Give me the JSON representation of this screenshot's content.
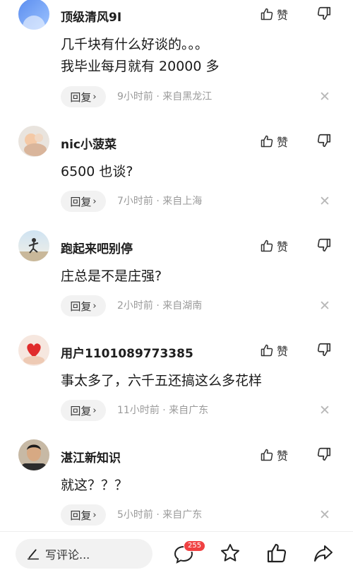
{
  "comments": [
    {
      "username": "顶级清风9I",
      "like_label": "赞",
      "lines": [
        "几千块有什么好谈的。。。",
        "我毕业每月就有 20000 多"
      ],
      "reply_label": "回复",
      "meta": "9小时前 · 来自黑龙江"
    },
    {
      "username": "nic小菠菜",
      "like_label": "赞",
      "lines": [
        "6500 也谈?"
      ],
      "reply_label": "回复",
      "meta": "7小时前 · 来自上海"
    },
    {
      "username": "跑起来吧别停",
      "like_label": "赞",
      "lines": [
        "庄总是不是庄强?"
      ],
      "reply_label": "回复",
      "meta": "2小时前 · 来自湖南"
    },
    {
      "username": "用户1101089773385",
      "like_label": "赞",
      "lines": [
        "事太多了，六千五还搞这么多花样"
      ],
      "reply_label": "回复",
      "meta": "11小时前 · 来自广东"
    },
    {
      "username": "湛江新知识",
      "like_label": "赞",
      "lines": [
        "就这？？？"
      ],
      "reply_label": "回复",
      "meta": "5小时前 · 来自广东"
    }
  ],
  "bottom_bar": {
    "write_placeholder": "写评论...",
    "comment_count": "255",
    "icons": [
      "comment-icon",
      "star-icon",
      "thumb-up-icon",
      "share-icon"
    ]
  },
  "colors": {
    "badge": "#f04142",
    "meta_text": "#9a9a9a",
    "pill_bg": "#f2f2f2"
  }
}
